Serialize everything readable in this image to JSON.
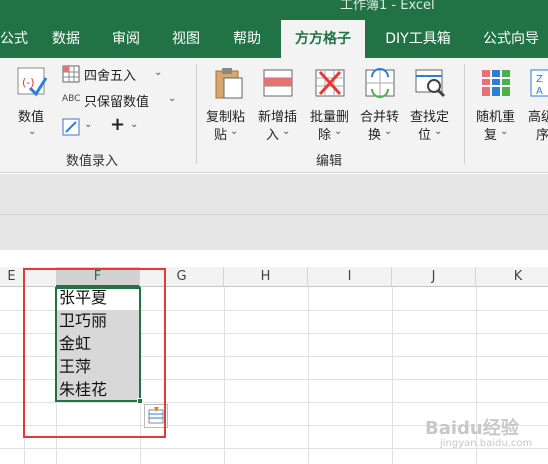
{
  "window": {
    "title": "工作簿1 - Excel"
  },
  "tabs": [
    {
      "label": "公式"
    },
    {
      "label": "数据"
    },
    {
      "label": "审阅"
    },
    {
      "label": "视图"
    },
    {
      "label": "帮助"
    },
    {
      "label": "方方格子",
      "active": true
    },
    {
      "label": "DIY工具箱"
    },
    {
      "label": "公式向导"
    }
  ],
  "ribbon": {
    "numeric_group": {
      "label": "数值录入",
      "value_button": "数值",
      "round_label": "四舍五入",
      "keep_value_label": "只保留数值",
      "abc_prefix": "ABC",
      "plus_label": "+"
    },
    "edit_group": {
      "label": "编辑",
      "buttons": [
        {
          "line1": "复制粘",
          "line2": "贴"
        },
        {
          "line1": "新增插",
          "line2": "入"
        },
        {
          "line1": "批量删",
          "line2": "除"
        },
        {
          "line1": "合并转",
          "line2": "换"
        },
        {
          "line1": "查找定",
          "line2": "位"
        }
      ]
    },
    "other_group": {
      "buttons": [
        {
          "line1": "随机重",
          "line2": "复"
        },
        {
          "line1": "高级",
          "line2": "序"
        }
      ]
    }
  },
  "sheet": {
    "columns": [
      "E",
      "F",
      "G",
      "H",
      "I",
      "J",
      "K"
    ],
    "selected_column": "F",
    "cells": [
      {
        "value": "张平夏",
        "highlighted": false
      },
      {
        "value": "卫巧丽",
        "highlighted": true
      },
      {
        "value": "金虹",
        "highlighted": true
      },
      {
        "value": "王萍",
        "highlighted": true
      },
      {
        "value": "朱桂花",
        "highlighted": true
      }
    ]
  },
  "watermark": {
    "text": "Baidu经验",
    "sub": "jingyan.baidu.com"
  },
  "colors": {
    "accent": "#217346",
    "annotation": "#e53935"
  }
}
